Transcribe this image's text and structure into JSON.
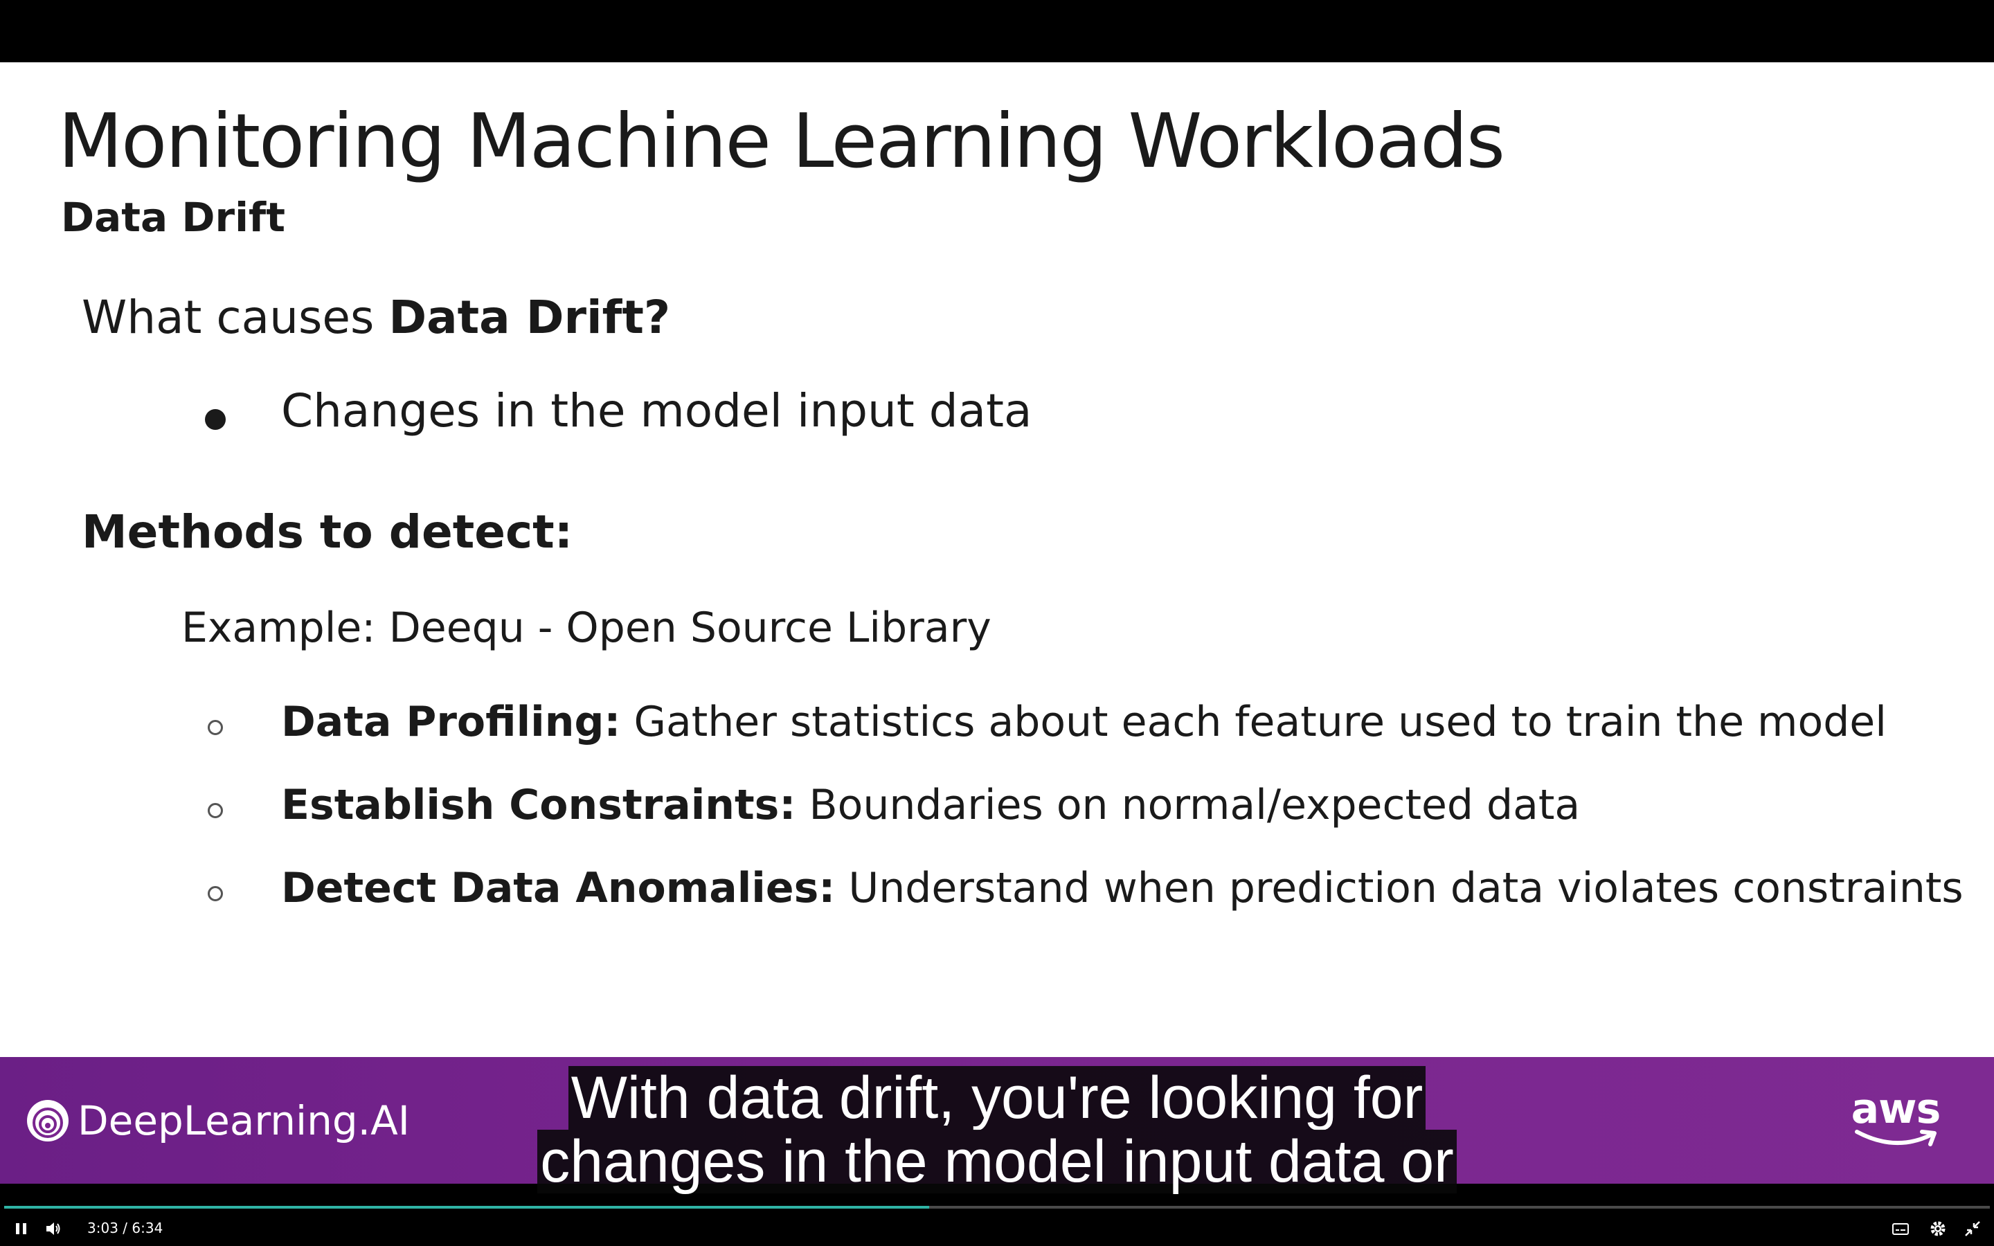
{
  "slide": {
    "title": "Monitoring Machine Learning Workloads",
    "subtitle": "Data Drift",
    "question_prefix": "What causes ",
    "question_bold": "Data Drift?",
    "bullet": "Changes in the model input data",
    "methods_heading": "Methods to detect:",
    "example": "Example: Deequ - Open Source Library",
    "sub_items": [
      {
        "bold": "Data Profiling:",
        "text": " Gather statistics about each feature used to train the model"
      },
      {
        "bold": "Establish Constraints:",
        "text": " Boundaries on normal/expected data"
      },
      {
        "bold": "Detect Data Anomalies:",
        "text": " Understand when prediction data violates constraints"
      }
    ]
  },
  "banner": {
    "logo_text": "DeepLearning.AI",
    "aws_text": "aws"
  },
  "caption": {
    "line1": "With data drift, you're looking for",
    "line2": "changes in the model input data or"
  },
  "player": {
    "current_time": "3:03",
    "separator": "/",
    "duration": "6:34",
    "progress_fraction": 0.466,
    "accent_color": "#2fb3a4",
    "icons": [
      "pause-icon",
      "volume-icon",
      "captions-icon",
      "settings-icon",
      "exit-fullscreen-icon"
    ]
  }
}
